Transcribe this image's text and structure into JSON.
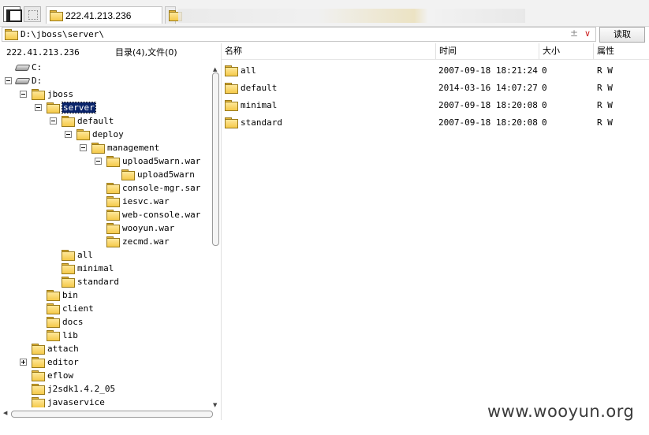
{
  "tabs": {
    "active_label": "222.41.213.236"
  },
  "address": {
    "path": "D:\\jboss\\server\\",
    "plus": "±",
    "dropdown": "∨",
    "read_button": "读取"
  },
  "left_header": {
    "ip": "222.41.213.236",
    "counts": "目录(4),文件(0)"
  },
  "tree": [
    {
      "label": "C:",
      "type": "drive"
    },
    {
      "label": "D:",
      "type": "drive"
    },
    {
      "label": "jboss",
      "type": "folder"
    },
    {
      "label": "server",
      "type": "folder",
      "selected": true
    },
    {
      "label": "default",
      "type": "folder"
    },
    {
      "label": "deploy",
      "type": "folder"
    },
    {
      "label": "management",
      "type": "folder"
    },
    {
      "label": "upload5warn.war",
      "type": "folder"
    },
    {
      "label": "upload5warn",
      "type": "folder"
    },
    {
      "label": "console-mgr.sar",
      "type": "folder"
    },
    {
      "label": "iesvc.war",
      "type": "folder"
    },
    {
      "label": "web-console.war",
      "type": "folder"
    },
    {
      "label": "wooyun.war",
      "type": "folder"
    },
    {
      "label": "zecmd.war",
      "type": "folder"
    },
    {
      "label": "all",
      "type": "folder"
    },
    {
      "label": "minimal",
      "type": "folder"
    },
    {
      "label": "standard",
      "type": "folder"
    },
    {
      "label": "bin",
      "type": "folder"
    },
    {
      "label": "client",
      "type": "folder"
    },
    {
      "label": "docs",
      "type": "folder"
    },
    {
      "label": "lib",
      "type": "folder"
    },
    {
      "label": "attach",
      "type": "folder"
    },
    {
      "label": "editor",
      "type": "folder"
    },
    {
      "label": "eflow",
      "type": "folder"
    },
    {
      "label": "j2sdk1.4.2_05",
      "type": "folder"
    },
    {
      "label": "javaservice",
      "type": "folder"
    }
  ],
  "list": {
    "columns": [
      "名称",
      "时间",
      "大小",
      "属性"
    ],
    "rows": [
      {
        "name": "all",
        "time": "2007-09-18 18:21:24",
        "size": "0",
        "attr": "R W"
      },
      {
        "name": "default",
        "time": "2014-03-16 14:07:27",
        "size": "0",
        "attr": "R W"
      },
      {
        "name": "minimal",
        "time": "2007-09-18 18:20:08",
        "size": "0",
        "attr": "R W"
      },
      {
        "name": "standard",
        "time": "2007-09-18 18:20:08",
        "size": "0",
        "attr": "R W"
      }
    ]
  },
  "watermark": "www.wooyun.org",
  "colors": {
    "selection": "#0a246a",
    "folder": "#f5c94a"
  }
}
